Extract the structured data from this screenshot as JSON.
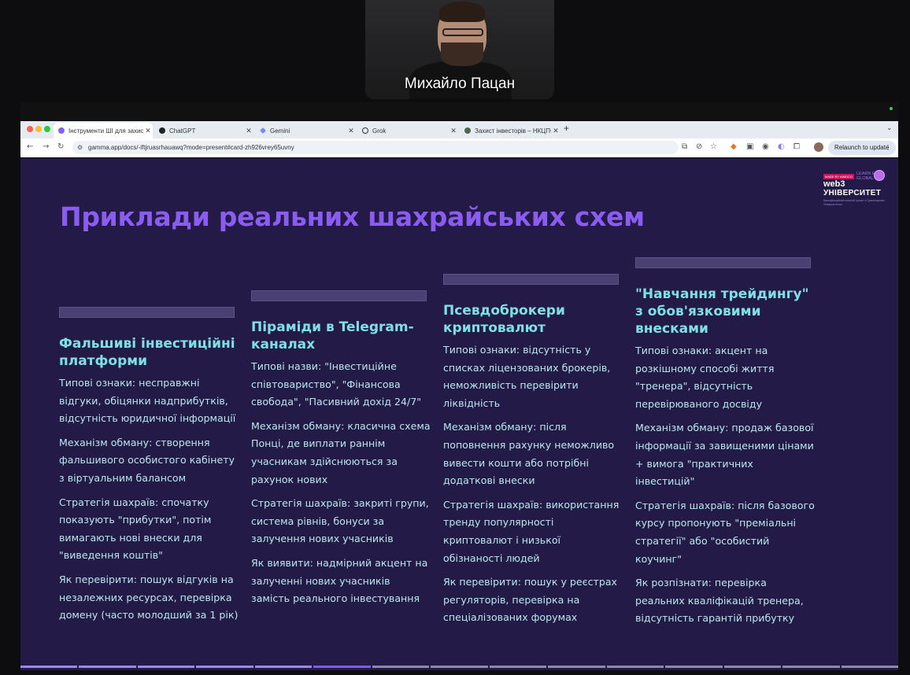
{
  "video": {
    "participant_name": "Михайло Пацан"
  },
  "browser": {
    "tabs": [
      {
        "label": "Інструменти ШІ для захисту",
        "active": true
      },
      {
        "label": "ChatGPT",
        "active": false
      },
      {
        "label": "Gemini",
        "active": false
      },
      {
        "label": "Grok",
        "active": false
      },
      {
        "label": "Захист інвесторів – НКЦПФР",
        "active": false
      }
    ],
    "url": "gamma.app/docs/-iftjruasrhauawq?mode=present#card-zh926vrey65uvny",
    "relaunch_label": "Relaunch to update"
  },
  "slide": {
    "logo": {
      "badge": "MADE BY AIMOCO",
      "line1": "web3",
      "line2": "УНІВЕРСИТЕТ",
      "tagline": "LEARN EARN GLOBAL",
      "subtitle": "Кваліфікаційний освітній проєкт з Гуманітарним Університетом"
    },
    "title": "Приклади реальних шахрайських схем",
    "columns": [
      {
        "heading": "Фальшиві інвестиційні платформи",
        "paragraphs": [
          "Типові ознаки: несправжні відгуки, обіцянки надприбутків, відсутність юридичної інформації",
          "Механізм обману: створення фальшивого особистого кабінету з віртуальним балансом",
          "Стратегія шахраїв: спочатку показують \"прибутки\", потім вимагають нові внески для \"виведення коштів\"",
          "Як перевірити: пошук відгуків на незалежних ресурсах, перевірка домену (часто молодший за 1 рік)"
        ]
      },
      {
        "heading": "Піраміди в Telegram-каналах",
        "paragraphs": [
          "Типові назви: \"Інвестиційне співтовариство\", \"Фінансова свобода\", \"Пасивний дохід 24/7\"",
          "Механізм обману: класична схема Понці, де виплати раннім учасникам здійснюються за рахунок нових",
          "Стратегія шахраїв: закриті групи, система рівнів, бонуси за залучення нових учасників",
          "Як виявити: надмірний акцент на залученні нових учасників замість реального інвестування"
        ]
      },
      {
        "heading": "Псевдоброкери криптовалют",
        "paragraphs": [
          "Типові ознаки: відсутність у списках ліцензованих брокерів, неможливість перевірити ліквідність",
          "Механізм обману: після поповнення рахунку неможливо вивести кошти або потрібні додаткові внески",
          "Стратегія шахраїв: використання тренду популярності криптовалют і низької обізнаності людей",
          "Як перевірити: пошук у реєстрах регуляторів, перевірка на спеціалізованих форумах"
        ]
      },
      {
        "heading": "\"Навчання трейдингу\" з обов'язковими внесками",
        "paragraphs": [
          "Типові ознаки: акцент на розкішному способі життя \"тренера\", відсутність перевірюваного досвіду",
          "Механізм обману: продаж базової інформації за завищеними цінами + вимога \"практичних інвестицій\"",
          "Стратегія шахраїв: після базового курсу пропонують \"преміальні стратегії\" або \"особистий коучинг\"",
          "Як розпізнати: перевірка реальних кваліфікацій тренера, відсутність гарантій прибутку"
        ]
      }
    ]
  }
}
